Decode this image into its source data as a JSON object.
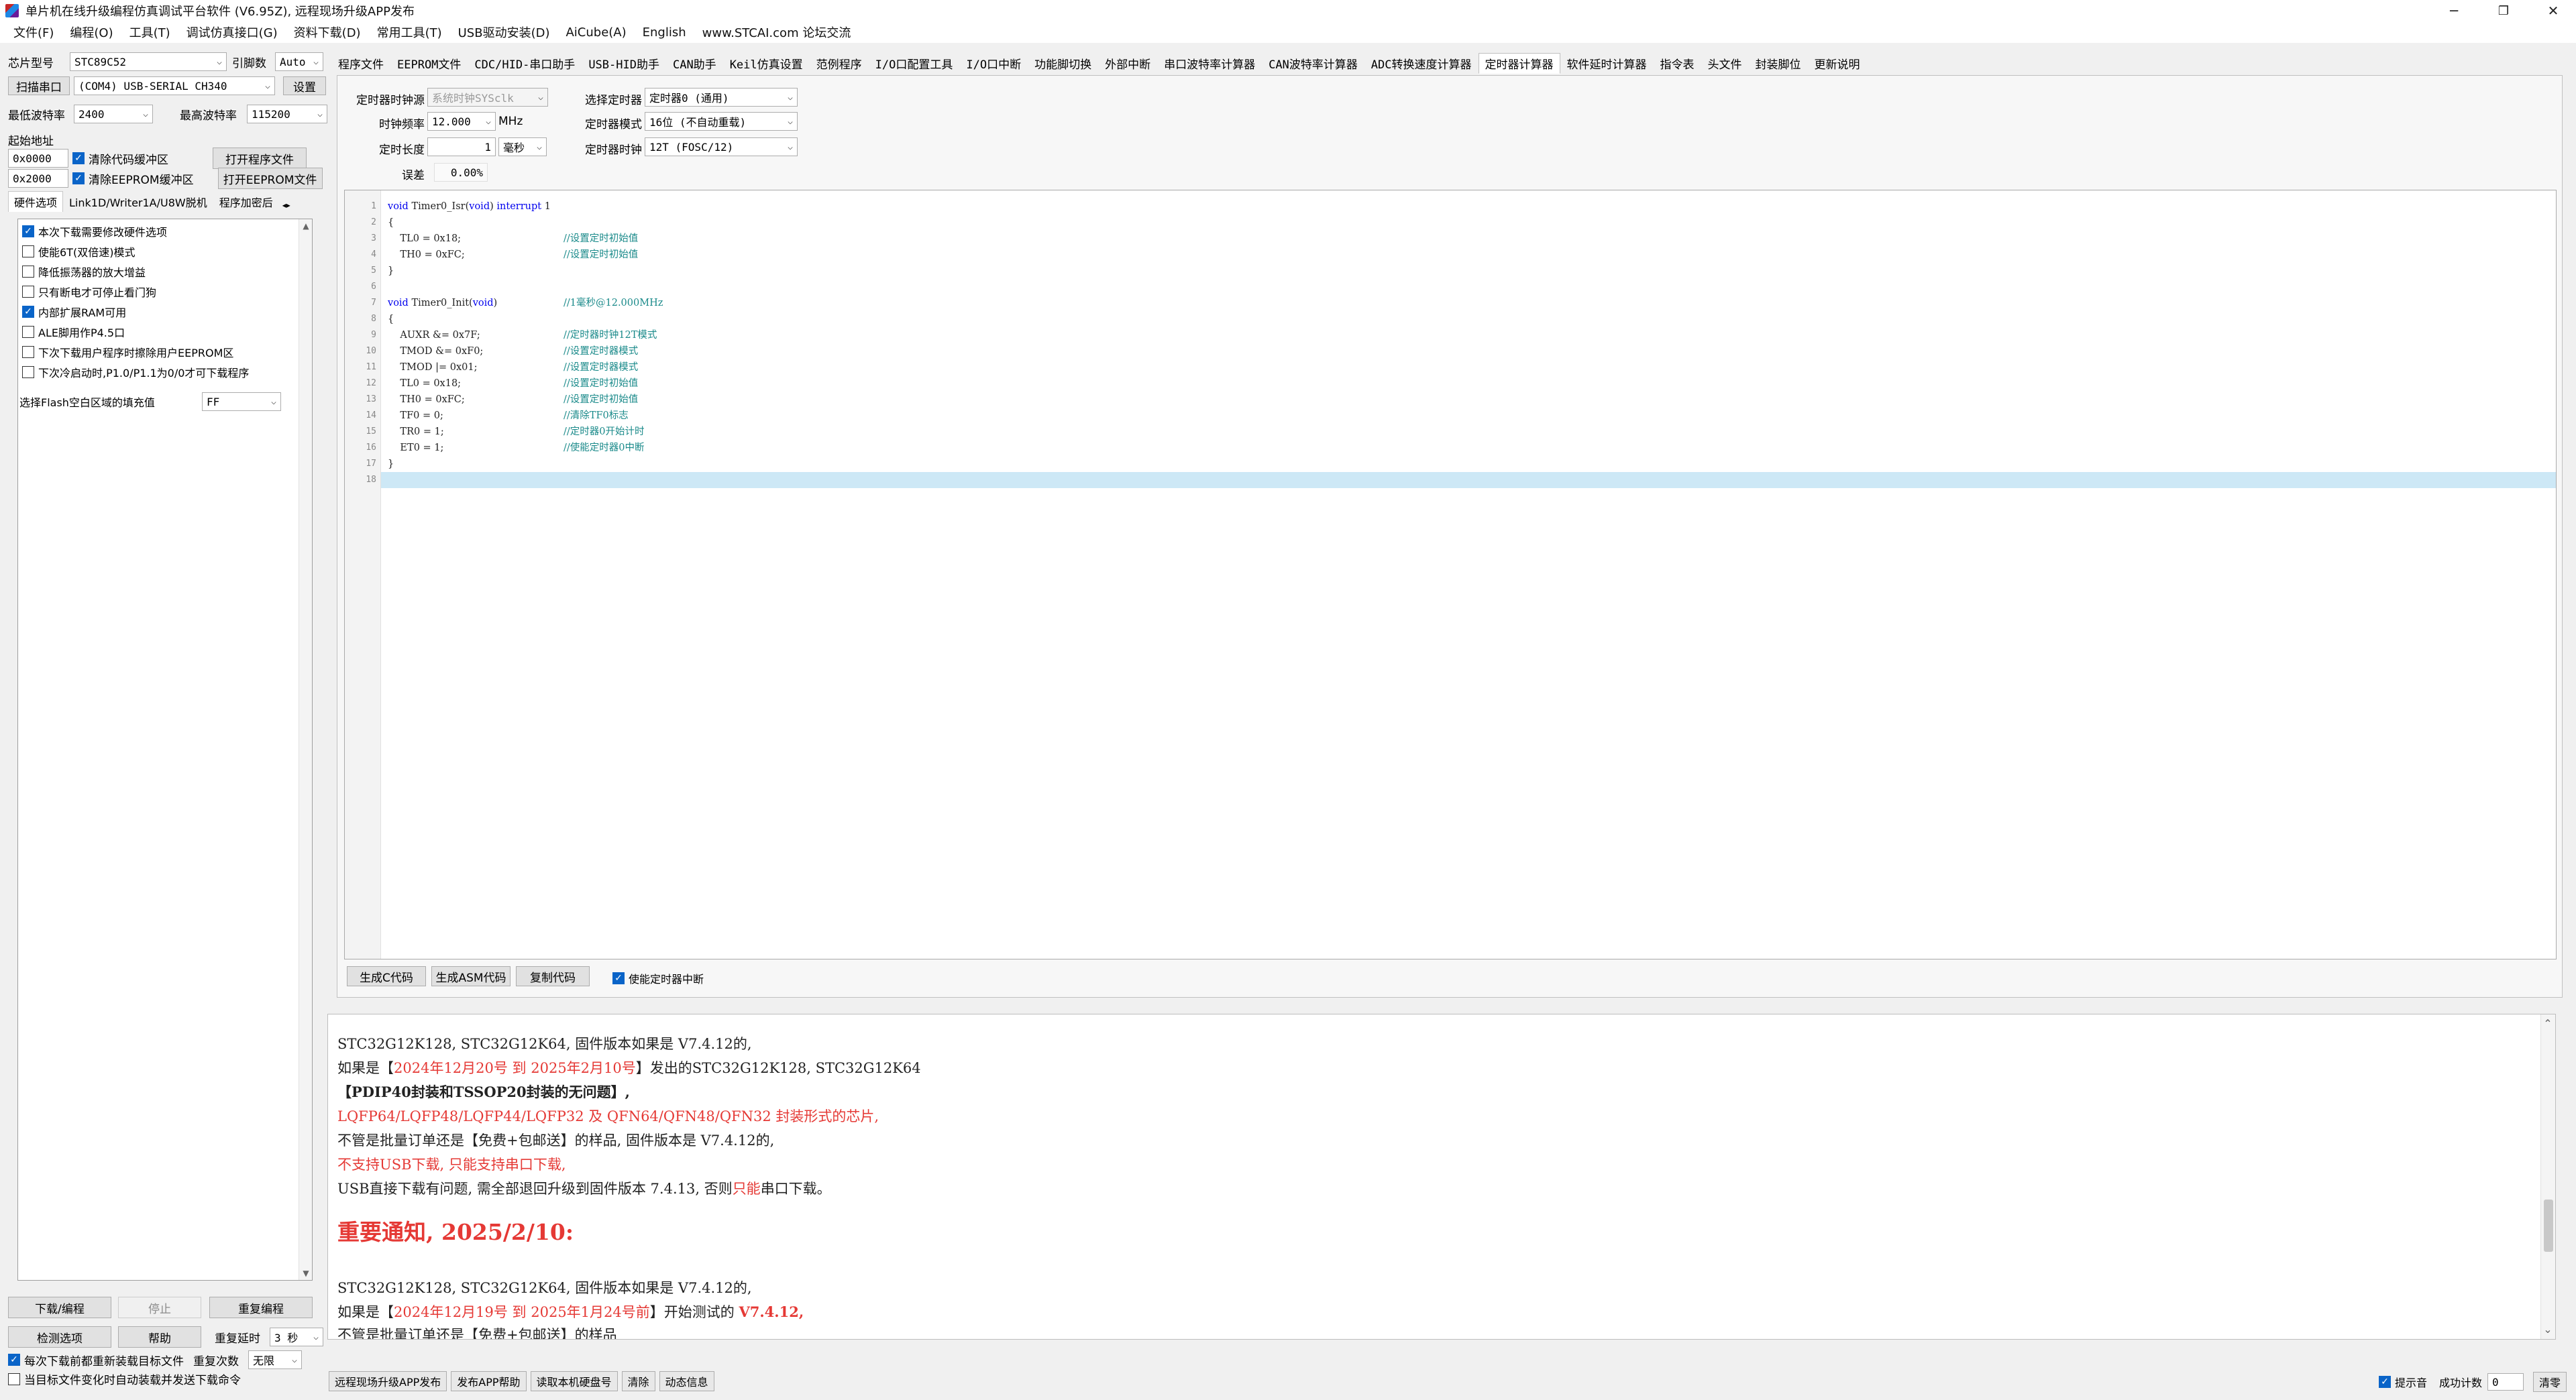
{
  "window": {
    "title": "单片机在线升级编程仿真调试平台软件 (V6.95Z), 远程现场升级APP发布",
    "minimize": "─",
    "maximize": "❐",
    "close": "✕"
  },
  "menu": [
    "文件(F)",
    "编程(O)",
    "工具(T)",
    "调试仿真接口(G)",
    "资料下载(D)",
    "常用工具(T)",
    "USB驱动安装(D)",
    "AiCube(A)",
    "English",
    "www.STCAI.com 论坛交流"
  ],
  "left": {
    "chip_label": "芯片型号",
    "chip_value": "STC89C52",
    "pin_label": "引脚数",
    "pin_value": "Auto",
    "scan_button": "扫描串口",
    "port_value": "(COM4) USB-SERIAL CH340",
    "settings_button": "设置",
    "min_baud_label": "最低波特率",
    "min_baud_value": "2400",
    "max_baud_label": "最高波特率",
    "max_baud_value": "115200",
    "start_addr_label": "起始地址",
    "addr1_value": "0x0000",
    "clear_code_label": "清除代码缓冲区",
    "open_program_button": "打开程序文件",
    "addr2_value": "0x2000",
    "clear_eeprom_label": "清除EEPROM缓冲区",
    "open_eeprom_button": "打开EEPROM文件",
    "tabs": [
      "硬件选项",
      "Link1D/Writer1A/U8W脱机",
      "程序加密后"
    ],
    "options": [
      {
        "label": "本次下载需要修改硬件选项",
        "checked": true
      },
      {
        "label": "使能6T(双倍速)模式",
        "checked": false
      },
      {
        "label": "降低振荡器的放大增益",
        "checked": false
      },
      {
        "label": "只有断电才可停止看门狗",
        "checked": false
      },
      {
        "label": "内部扩展RAM可用",
        "checked": true
      },
      {
        "label": "ALE脚用作P4.5口",
        "checked": false
      },
      {
        "label": "下次下载用户程序时擦除用户EEPROM区",
        "checked": false
      },
      {
        "label": "下次冷启动时,P1.0/P1.1为0/0才可下载程序",
        "checked": false
      }
    ],
    "flash_fill_label": "选择Flash空白区域的填充值",
    "flash_fill_value": "FF",
    "download_button": "下载/编程",
    "stop_button": "停止",
    "reprogram_button": "重复编程",
    "check_options_button": "检测选项",
    "help_button": "帮助",
    "repeat_delay_label": "重复延时",
    "repeat_delay_value": "3 秒",
    "repeat_count_label": "重复次数",
    "repeat_count_value": "无限",
    "reload_label": "每次下载前都重新装载目标文件",
    "auto_send_label": "当目标文件变化时自动装载并发送下载命令"
  },
  "right_tabs": [
    "程序文件",
    "EEPROM文件",
    "CDC/HID-串口助手",
    "USB-HID助手",
    "CAN助手",
    "Keil仿真设置",
    "范例程序",
    "I/O口配置工具",
    "I/O口中断",
    "功能脚切换",
    "外部中断",
    "串口波特率计算器",
    "CAN波特率计算器",
    "ADC转换速度计算器",
    "定时器计算器",
    "软件延时计算器",
    "指令表",
    "头文件",
    "封装脚位",
    "更新说明"
  ],
  "active_right_tab": 14,
  "calc": {
    "clock_source_label": "定时器时钟源",
    "clock_source_value": "系统时钟SYSclk",
    "freq_label": "时钟频率",
    "freq_value": "12.000",
    "freq_unit": "MHz",
    "length_label": "定时长度",
    "length_value": "1",
    "length_unit": "毫秒",
    "error_label": "误差",
    "error_value": "0.00%",
    "timer_select_label": "选择定时器",
    "timer_select_value": "定时器0 (通用)",
    "mode_label": "定时器模式",
    "mode_value": "16位 (不自动重载)",
    "timer_clock_label": "定时器时钟",
    "timer_clock_value": "12T (FOSC/12)",
    "gen_c_button": "生成C代码",
    "gen_asm_button": "生成ASM代码",
    "copy_button": "复制代码",
    "enable_int_label": "使能定时器中断"
  },
  "code_lines": [
    {
      "n": "1",
      "t": "void Timer0_Isr(void) interrupt 1",
      "c": ""
    },
    {
      "n": "2",
      "t": "{",
      "c": ""
    },
    {
      "n": "3",
      "t": "    TL0 = 0x18;",
      "c": "//设置定时初始值"
    },
    {
      "n": "4",
      "t": "    TH0 = 0xFC;",
      "c": "//设置定时初始值"
    },
    {
      "n": "5",
      "t": "}",
      "c": ""
    },
    {
      "n": "6",
      "t": "",
      "c": ""
    },
    {
      "n": "7",
      "t": "void Timer0_Init(void)",
      "c": "//1毫秒@12.000MHz"
    },
    {
      "n": "8",
      "t": "{",
      "c": ""
    },
    {
      "n": "9",
      "t": "    AUXR &= 0x7F;",
      "c": "//定时器时钟12T模式"
    },
    {
      "n": "10",
      "t": "    TMOD &= 0xF0;",
      "c": "//设置定时器模式"
    },
    {
      "n": "11",
      "t": "    TMOD |= 0x01;",
      "c": "//设置定时器模式"
    },
    {
      "n": "12",
      "t": "    TL0 = 0x18;",
      "c": "//设置定时初始值"
    },
    {
      "n": "13",
      "t": "    TH0 = 0xFC;",
      "c": "//设置定时初始值"
    },
    {
      "n": "14",
      "t": "    TF0 = 0;",
      "c": "//清除TF0标志"
    },
    {
      "n": "15",
      "t": "    TR0 = 1;",
      "c": "//定时器0开始计时"
    },
    {
      "n": "16",
      "t": "    ET0 = 1;",
      "c": "//使能定时器0中断"
    },
    {
      "n": "17",
      "t": "}",
      "c": ""
    },
    {
      "n": "18",
      "t": "",
      "c": ""
    }
  ],
  "messages": {
    "l1": "STC32G12K128, STC32G12K64, 固件版本如果是 V7.4.12的,",
    "l2a": "如果是【",
    "l2b": "2024年12月20号 到 2025年2月10号",
    "l2c": "】发出的STC32G12K128, STC32G12K64",
    "l3": "【PDIP40封装和TSSOP20封装的无问题】,",
    "l4": "LQFP64/LQFP48/LQFP44/LQFP32 及 QFN64/QFN48/QFN32 封装形式的芯片,",
    "l5": "不管是批量订单还是【免费+包邮送】的样品, 固件版本是 V7.4.12的,",
    "l6": "不支持USB下载, 只能支持串口下载,",
    "l7a": "USB直接下载有问题, 需全部退回升级到固件版本 7.4.13, 否则",
    "l7b": "只能",
    "l7c": "串口下载。",
    "l8": "重要通知, 2025/2/10:",
    "l9": "STC32G12K128, STC32G12K64, 固件版本如果是 V7.4.12的,",
    "l10a": "如果是【",
    "l10b": "2024年12月19号 到 2025年1月24号前",
    "l10c": "】开始测试的 ",
    "l10d": "V7.4.12,",
    "l11": "不管是批量订单还是【免费+包邮送】的样品"
  },
  "status": {
    "remote_app_button": "远程现场升级APP发布",
    "publish_help_button": "发布APP帮助",
    "read_disk_button": "读取本机硬盘号",
    "clear_button": "清除",
    "dynamic_info_button": "动态信息",
    "prompt_sound_label": "提示音",
    "success_count_label": "成功计数",
    "success_count_value": "0",
    "clear_zero_button": "清零"
  }
}
